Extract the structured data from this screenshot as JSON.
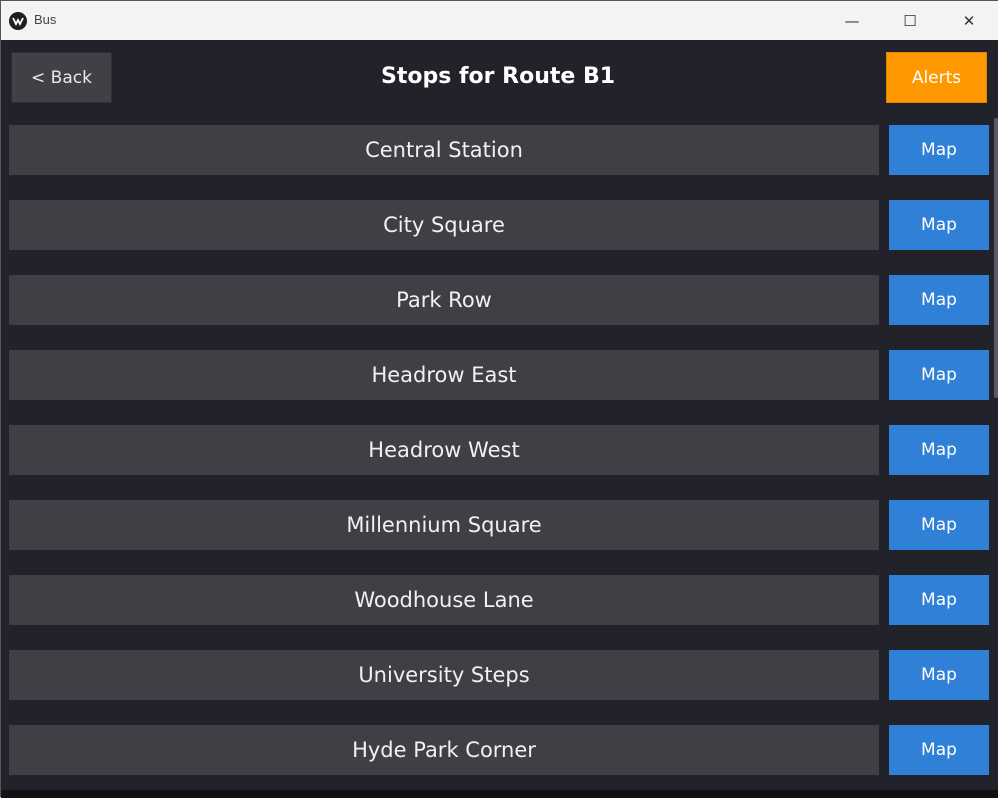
{
  "window": {
    "title": "Bus",
    "controls": {
      "minimize": "—",
      "maximize": "☐",
      "close": "✕"
    }
  },
  "header": {
    "back_label": "< Back",
    "title": "Stops for Route B1",
    "alerts_label": "Alerts"
  },
  "stops": [
    {
      "name": "Central Station",
      "map_label": "Map"
    },
    {
      "name": "City Square",
      "map_label": "Map"
    },
    {
      "name": "Park Row",
      "map_label": "Map"
    },
    {
      "name": "Headrow East",
      "map_label": "Map"
    },
    {
      "name": "Headrow West",
      "map_label": "Map"
    },
    {
      "name": "Millennium Square",
      "map_label": "Map"
    },
    {
      "name": "Woodhouse Lane",
      "map_label": "Map"
    },
    {
      "name": "University Steps",
      "map_label": "Map"
    },
    {
      "name": "Hyde Park Corner",
      "map_label": "Map"
    }
  ],
  "colors": {
    "background": "#22232a",
    "row": "#3f4045",
    "map_button": "#2f80d6",
    "alerts_button": "#ff9800",
    "back_button": "#404146"
  }
}
